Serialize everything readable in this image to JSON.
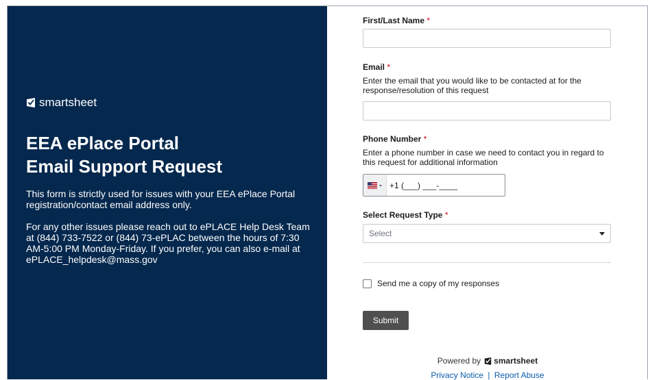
{
  "left": {
    "brand": "smartsheet",
    "title_line1": "EEA ePlace Portal",
    "title_line2": "Email Support Request",
    "paragraph1": "This form is strictly used for issues with your EEA ePlace Portal registration/contact email address only.",
    "paragraph2": "For any other issues please reach out to ePLACE Help Desk Team at (844) 733-7522 or (844) 73-ePLAC between the hours of 7:30 AM-5:00 PM Monday-Friday. If you prefer, you can also e-mail at ePLACE_helpdesk@mass.gov"
  },
  "form": {
    "name": {
      "label": "First/Last Name",
      "required": "*",
      "value": ""
    },
    "email": {
      "label": "Email",
      "required": "*",
      "help": "Enter the email that you would like to be contacted at for the response/resolution of this request",
      "value": ""
    },
    "phone": {
      "label": "Phone Number",
      "required": "*",
      "help": "Enter a phone number in case we need to contact you in regard to this request for additional information",
      "value": "+1 (___) ___-____"
    },
    "request_type": {
      "label": "Select Request Type",
      "required": "*",
      "selected": "Select"
    },
    "copy_label": "Send me a copy of my responses",
    "submit_label": "Submit"
  },
  "footer": {
    "powered_by": "Powered by",
    "powered_brand": "smartsheet",
    "privacy": "Privacy Notice",
    "separator": "|",
    "report": "Report Abuse"
  },
  "colors": {
    "left_bg": "#05284e",
    "submit_bg": "#4f4f4f",
    "required": "#d0021b",
    "link": "#0b5cab"
  }
}
